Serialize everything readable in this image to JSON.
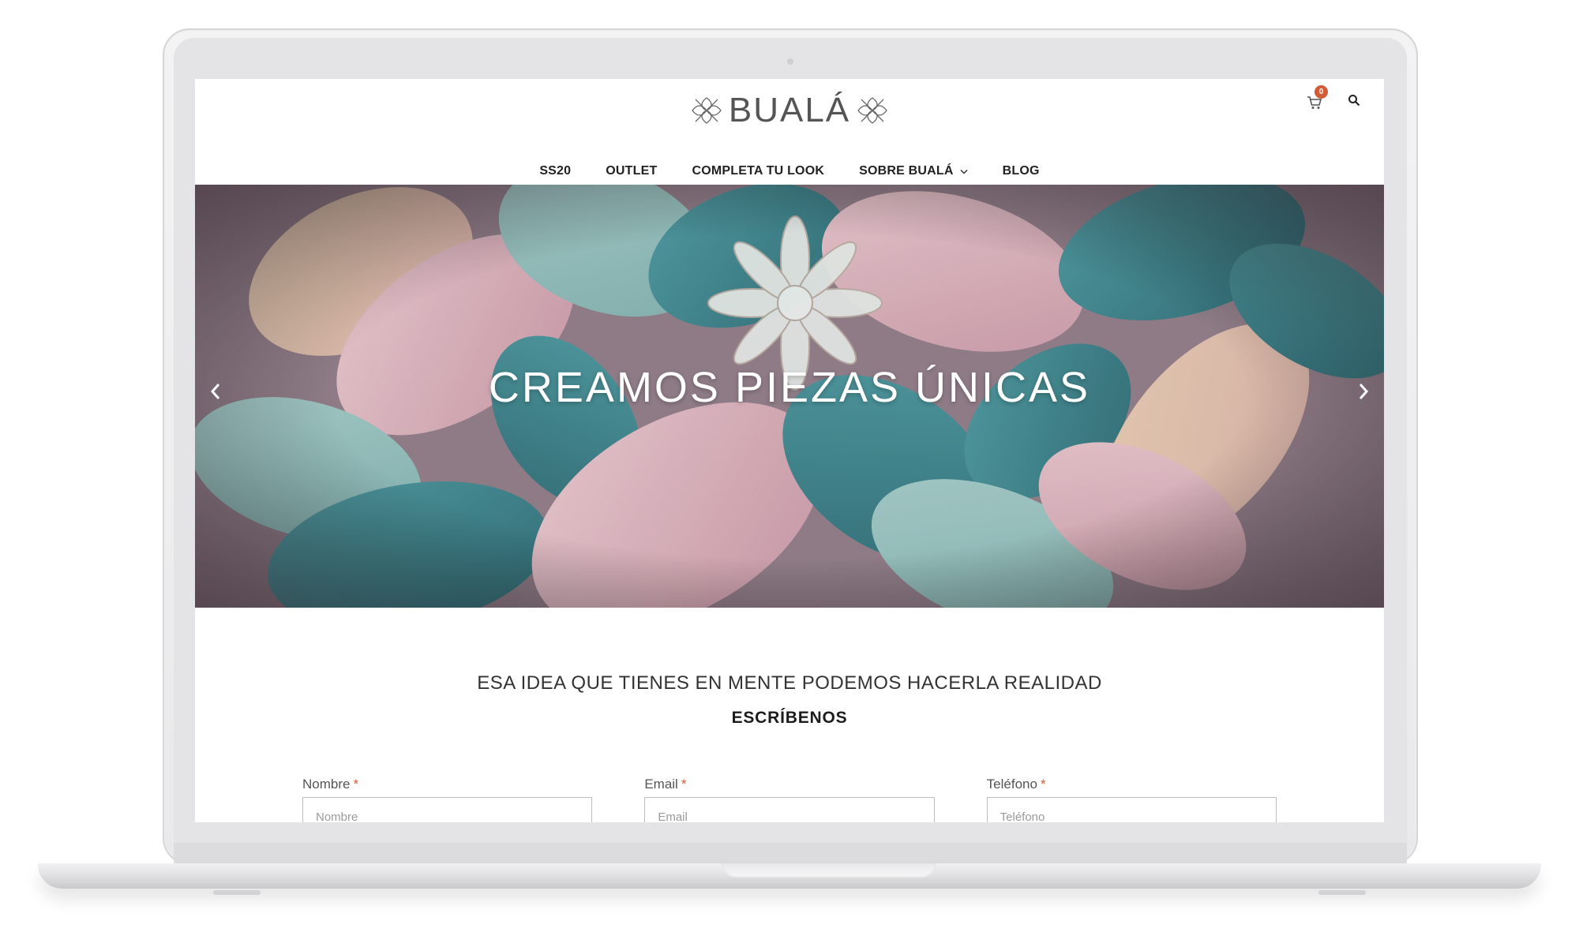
{
  "brand": {
    "name": "BUALÁ"
  },
  "header": {
    "cart_count": "0"
  },
  "nav": {
    "items": [
      {
        "label": "SS20"
      },
      {
        "label": "OUTLET"
      },
      {
        "label": "COMPLETA TU LOOK"
      },
      {
        "label": "SOBRE BUALÁ"
      },
      {
        "label": "BLOG"
      }
    ]
  },
  "hero": {
    "title": "CREAMOS PIEZAS ÚNICAS"
  },
  "section": {
    "tagline": "ESA IDEA QUE TIENES EN MENTE PODEMOS HACERLA REALIDAD",
    "subhead": "ESCRÍBENOS"
  },
  "form": {
    "fields": [
      {
        "label": "Nombre",
        "required_mark": "*",
        "placeholder": "Nombre"
      },
      {
        "label": "Email",
        "required_mark": "*",
        "placeholder": "Email"
      },
      {
        "label": "Teléfono",
        "required_mark": "*",
        "placeholder": "Teléfono"
      }
    ]
  },
  "colors": {
    "accent": "#d35b35",
    "text": "#222222"
  },
  "icons": {
    "cart": "cart-icon",
    "search": "search-icon",
    "dropdown": "chevron-down-icon",
    "prev": "chevron-left-icon",
    "next": "chevron-right-icon"
  }
}
